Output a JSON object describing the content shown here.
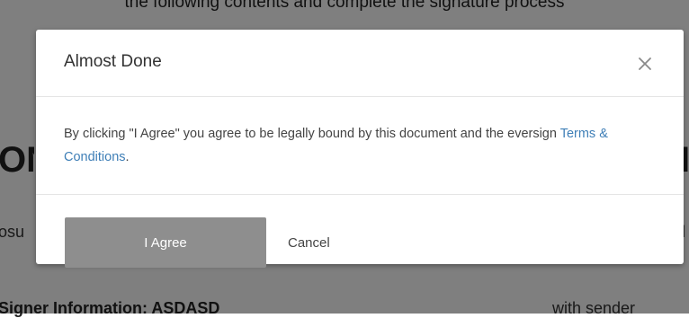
{
  "page": {
    "top_text": "the following contents and complete the signature process",
    "heading_fragment": "ON",
    "heading_right_fragment": "I",
    "sub_fragment": "osu",
    "sub_right_fragment": "l",
    "bottom_label": "Signer Information: ASDASD",
    "bottom_right_text": "with sender"
  },
  "modal": {
    "title": "Almost Done",
    "close_glyph": "×",
    "body_text_before": "By clicking \"I Agree\" you agree to be legally bound by this document and the eversign ",
    "terms_link": "Terms & Conditions",
    "body_text_after": ".",
    "agree_label": "I Agree",
    "cancel_label": "Cancel"
  },
  "colors": {
    "link": "#3f7fb7",
    "agree_button": "#8e8e8e",
    "overlay": "rgba(0,0,0,0.5)"
  }
}
